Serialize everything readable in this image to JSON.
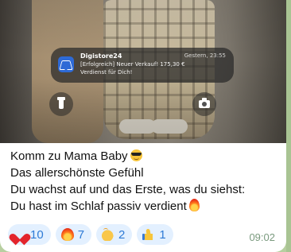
{
  "notification": {
    "app_name": "Digistore24",
    "time": "Gestern, 23:55",
    "line1": "[Erfolgreich] Neuer Verkauf! 175,30 €",
    "line2": "Verdienst für Dich!"
  },
  "message": {
    "lines": [
      "Komm zu Mama Baby",
      "Das allerschönste Gefühl",
      "Du wachst auf und das Erste, was du siehst:",
      "Du hast im Schlaf passiv verdient"
    ],
    "timestamp": "09:02"
  },
  "reactions": [
    {
      "icon": "heart-icon",
      "count": "10"
    },
    {
      "icon": "fire-icon",
      "count": "7"
    },
    {
      "icon": "clap-icon",
      "count": "2"
    },
    {
      "icon": "thumbs-up-icon",
      "count": "1"
    }
  ],
  "colors": {
    "chat_background": "#b7cfa0",
    "reaction_pill": "#e3f0ff",
    "reaction_text": "#2f7bd6",
    "timestamp": "#7a9a7e"
  }
}
